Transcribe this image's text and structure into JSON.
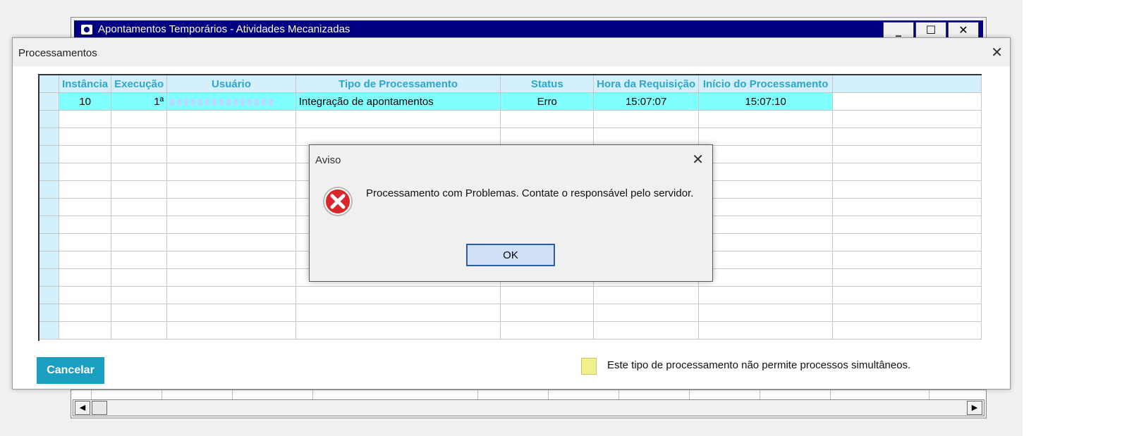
{
  "background_window": {
    "title": "Apontamentos Temporários - Atividades Mecanizadas",
    "minimize_label": "_",
    "maximize_label": "☐",
    "close_label": "✕"
  },
  "processamentos": {
    "title": "Processamentos",
    "close_label": "✕",
    "columns": [
      "Instância",
      "Execução",
      "Usuário",
      "Tipo de Processamento",
      "Status",
      "Hora da Requisição",
      "Início do Processamento"
    ],
    "row": {
      "instancia": "10",
      "execucao": "1ª",
      "tipo": "Integração de apontamentos",
      "status": "Erro",
      "hora_requisicao": "15:07:07",
      "inicio_processamento": "15:07:10"
    },
    "cancel_label": "Cancelar",
    "legend_text": "Este tipo de processamento não permite processos simultâneos."
  },
  "aviso": {
    "title": "Aviso",
    "close_label": "✕",
    "message": "Processamento com Problemas. Contate o responsável pelo servidor.",
    "ok_label": "OK",
    "icon": "error-icon"
  },
  "colors": {
    "header_bg": "#d4f0fc",
    "header_text": "#2aa7d0",
    "selected_row": "#80ffff",
    "cancel_button": "#1a9fc0",
    "legend_swatch": "#f0f08c",
    "titlebar": "#000080"
  }
}
